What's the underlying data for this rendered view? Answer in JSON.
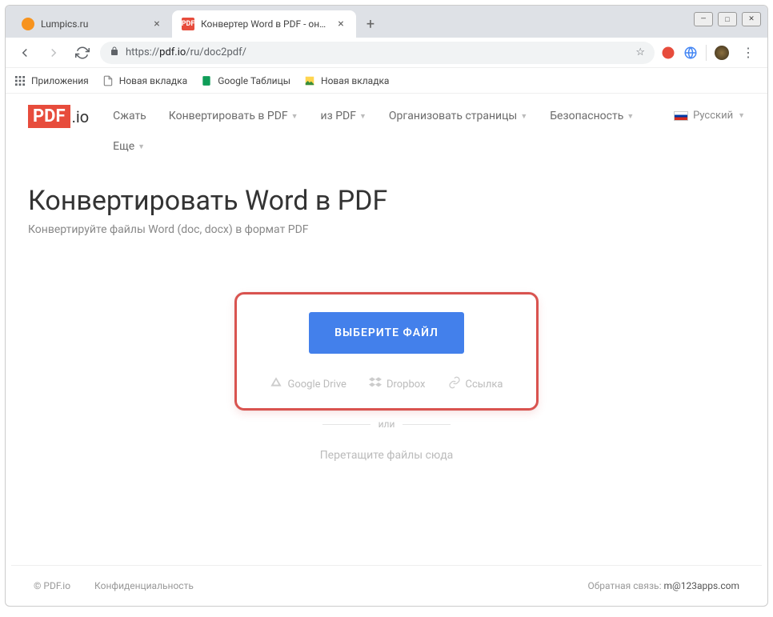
{
  "window": {
    "minimize": "—",
    "maximize": "□",
    "close": "✕"
  },
  "tabs": [
    {
      "title": "Lumpics.ru",
      "favicon_bg": "#f7931e",
      "favicon_text": ""
    },
    {
      "title": "Конвертер Word в PDF - онлай...",
      "favicon_bg": "#e74c3c",
      "favicon_text": "PDF"
    }
  ],
  "address": {
    "protocol": "https://",
    "host": "pdf.io",
    "path": "/ru/doc2pdf/"
  },
  "bookmarks": {
    "apps": "Приложения",
    "items": [
      "Новая вкладка",
      "Google Таблицы",
      "Новая вкладка"
    ]
  },
  "logo": {
    "pdf": "PDF",
    "io": ".io"
  },
  "nav": {
    "compress": "Сжать",
    "to_pdf": "Конвертировать в PDF",
    "from_pdf": "из PDF",
    "organize": "Организовать страницы",
    "security": "Безопасность",
    "more": "Еще"
  },
  "lang": "Русский",
  "hero": {
    "title": "Конвертировать Word в PDF",
    "subtitle": "Конвертируйте файлы Word (doc, docx) в формат PDF"
  },
  "upload": {
    "choose": "ВЫБЕРИТЕ ФАЙЛ",
    "gdrive": "Google Drive",
    "dropbox": "Dropbox",
    "link": "Ссылка",
    "or": "или",
    "drop": "Перетащите файлы сюда"
  },
  "footer": {
    "copyright": "© PDF.io",
    "privacy": "Конфиденциальность",
    "feedback_label": "Обратная связь: ",
    "feedback_email": "m@123apps.com"
  }
}
